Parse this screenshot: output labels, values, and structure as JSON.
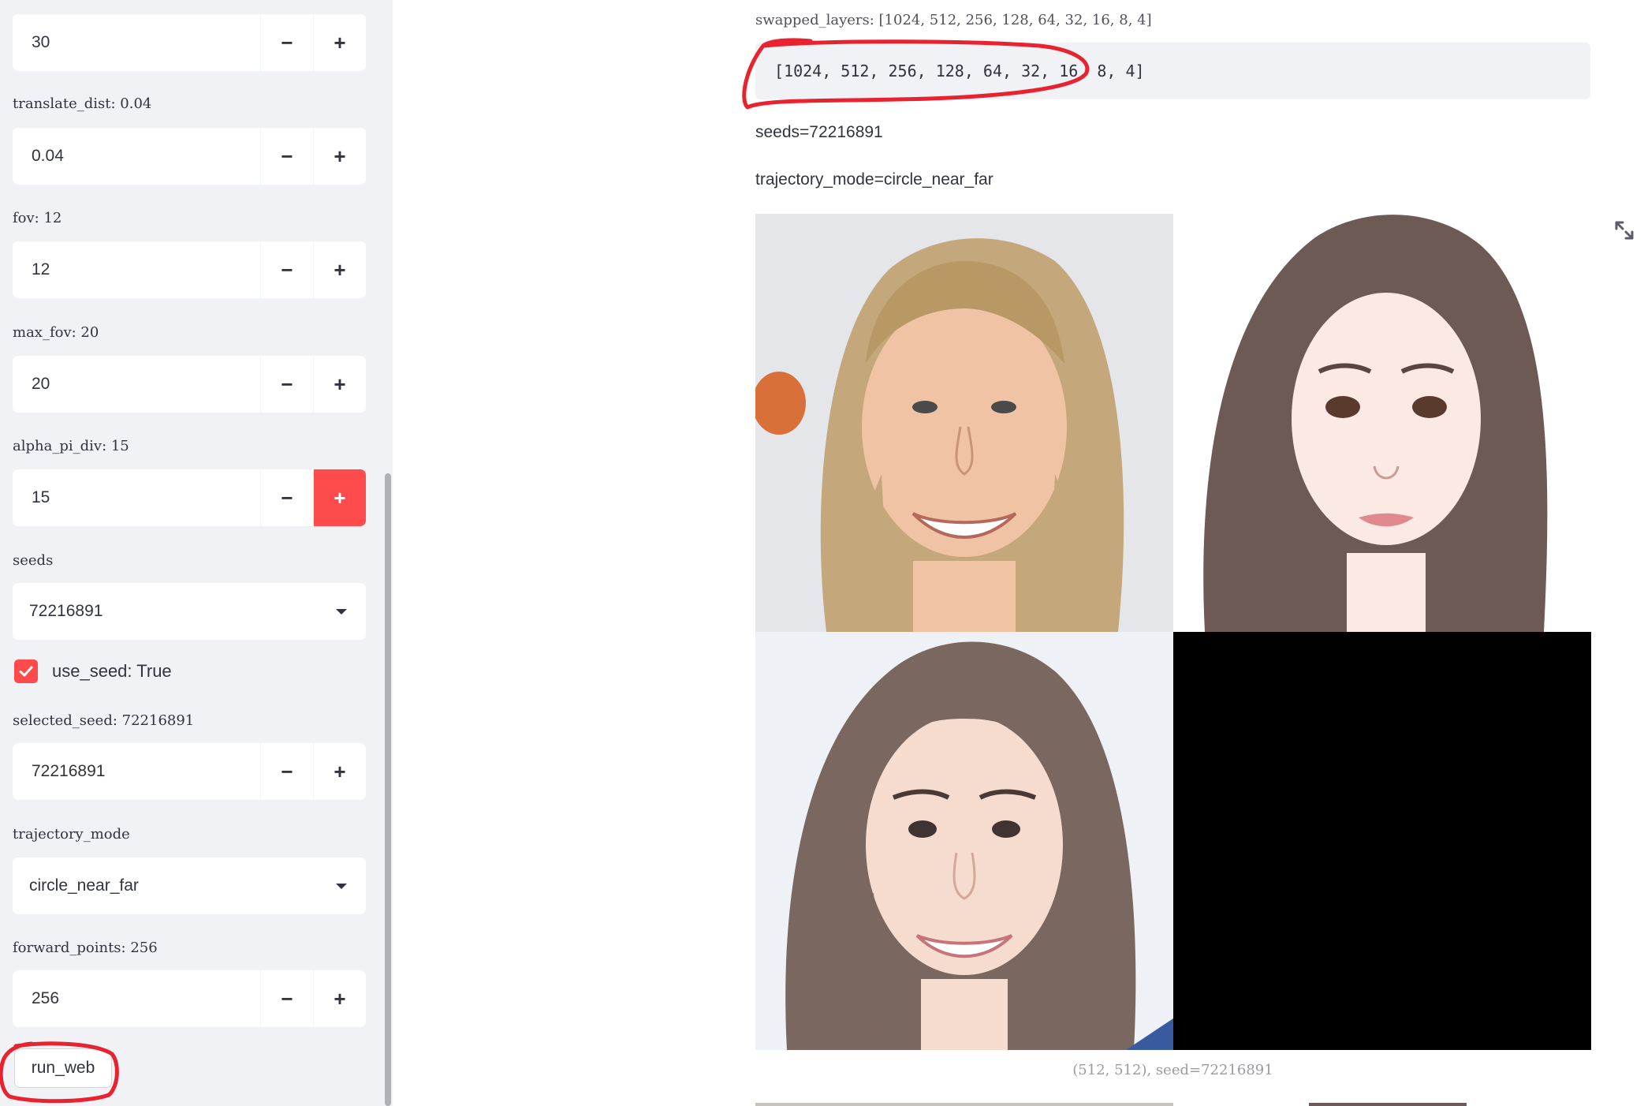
{
  "sidebar": {
    "steppers": [
      {
        "label": "",
        "value": "30"
      },
      {
        "label": "translate_dist: 0.04",
        "value": "0.04"
      },
      {
        "label": "fov: 12",
        "value": "12"
      },
      {
        "label": "max_fov: 20",
        "value": "20"
      },
      {
        "label": "alpha_pi_div: 15",
        "value": "15"
      }
    ],
    "seeds": {
      "label": "seeds",
      "value": "72216891"
    },
    "use_seed": {
      "label": "use_seed: True",
      "checked": true
    },
    "selected_seed": {
      "label": "selected_seed: 72216891",
      "value": "72216891"
    },
    "trajectory_mode": {
      "label": "trajectory_mode",
      "value": "circle_near_far"
    },
    "forward_points": {
      "label": "forward_points: 256",
      "value": "256"
    },
    "run_button": "run_web",
    "minus_glyph": "−",
    "plus_glyph": "+"
  },
  "main": {
    "swapped_layers_label": "swapped_layers: [1024, 512, 256, 128, 64, 32, 16, 8, 4]",
    "swapped_layers_code": "[1024, 512, 256, 128, 64, 32, 16, 8, 4]",
    "seeds_line": "seeds=72216891",
    "trajectory_line": "trajectory_mode=circle_near_far",
    "image_caption": "(512, 512), seed=72216891"
  },
  "colors": {
    "accent": "#ff4b4b",
    "sidebar_bg": "#f0f2f6",
    "text": "#31333f",
    "annotation_red": "#e8232f"
  },
  "icons": [
    "minus-icon",
    "plus-icon",
    "caret-down-icon",
    "check-icon",
    "expand-icon"
  ]
}
